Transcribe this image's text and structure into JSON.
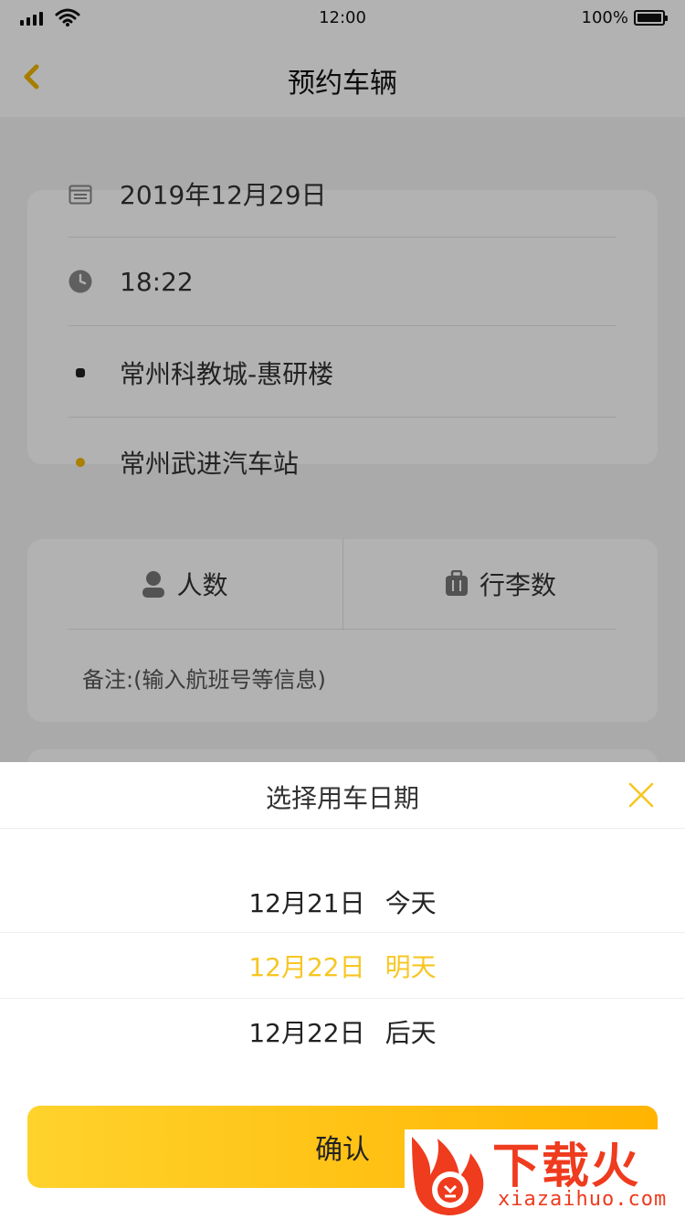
{
  "status_bar": {
    "time": "12:00",
    "battery": "100%"
  },
  "nav": {
    "title": "预约车辆"
  },
  "trip": {
    "date": "2019年12月29日",
    "time": "18:22",
    "from": "常州科教城-惠研楼",
    "to": "常州武进汽车站"
  },
  "extras": {
    "passengers_label": "人数",
    "luggage_label": "行李数",
    "note_placeholder": "备注:(输入航班号等信息)"
  },
  "sheet": {
    "title": "选择用车日期",
    "options": [
      {
        "date": "12月21日",
        "day": "今天"
      },
      {
        "date": "12月22日",
        "day": "明天"
      },
      {
        "date": "12月22日",
        "day": "后天"
      }
    ],
    "selected_index": 1,
    "confirm_label": "确认"
  },
  "watermark": {
    "brand": "下载火",
    "site": "xiazaihuo.com"
  },
  "colors": {
    "accent": "#f7c622",
    "brand_red": "#ef3b1e"
  }
}
